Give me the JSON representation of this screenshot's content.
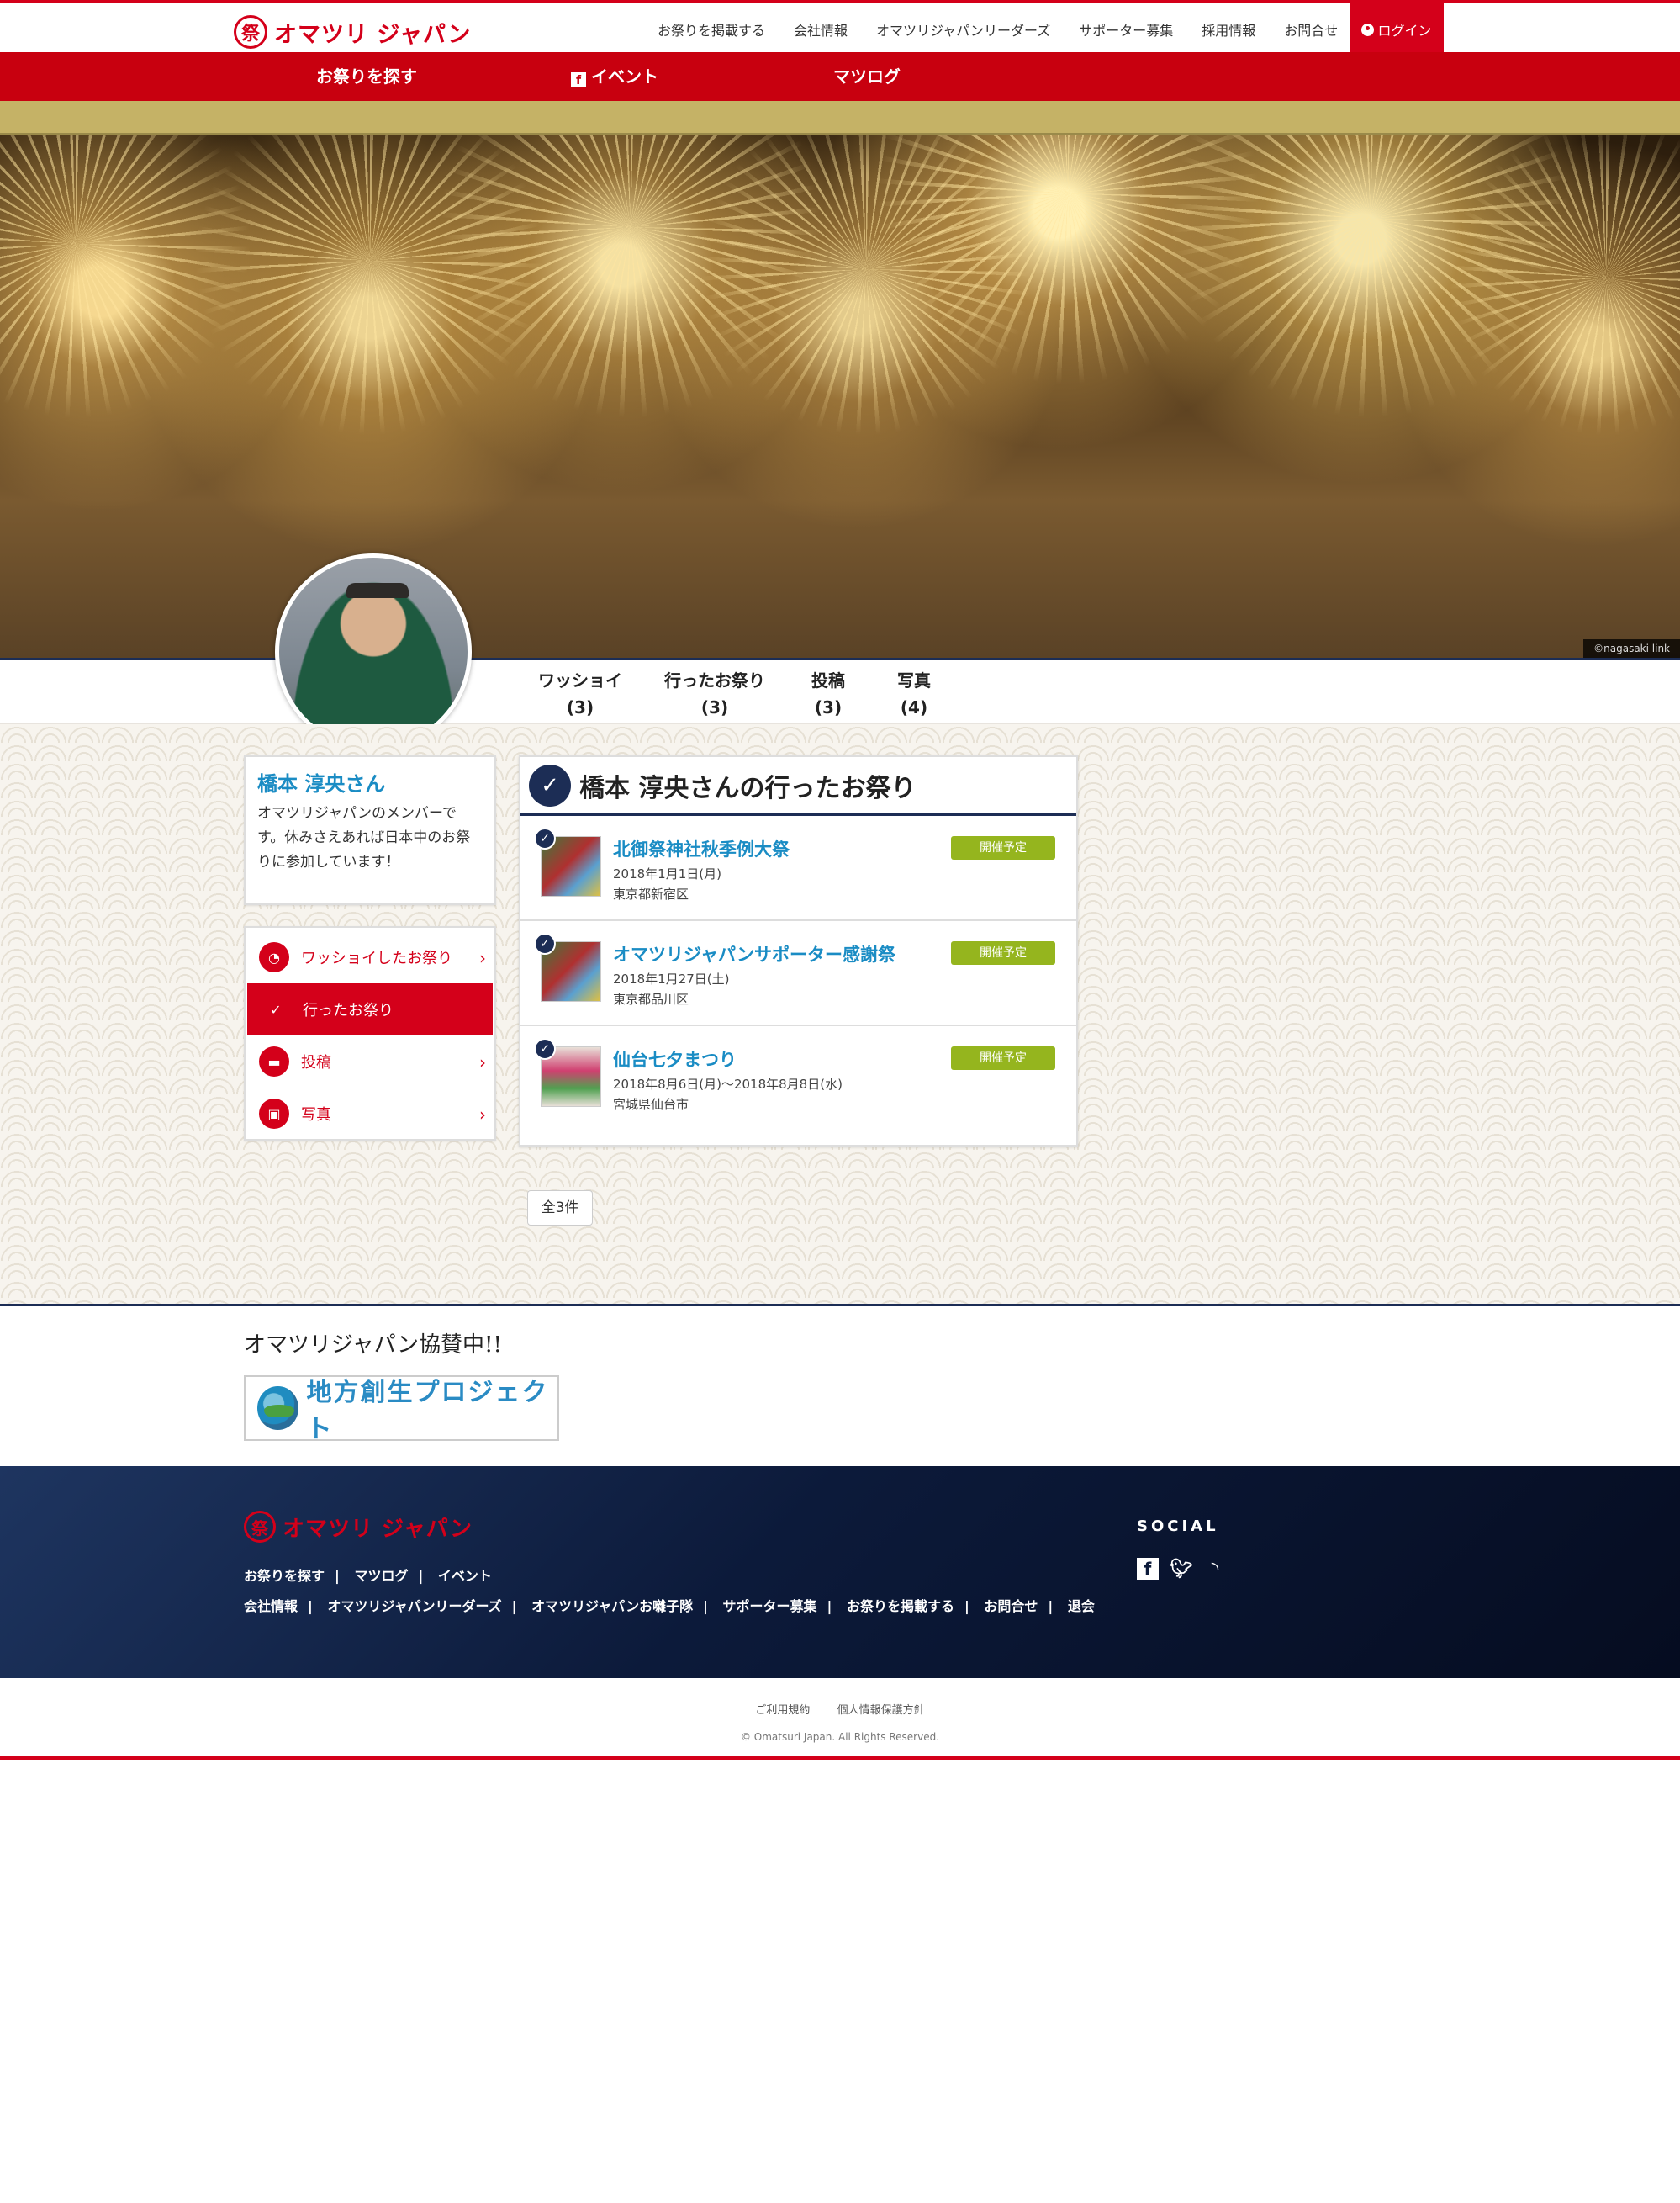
{
  "brand": {
    "logo_mark": "祭",
    "name": "オマツリ ジャパン"
  },
  "topnav": [
    "お祭りを掲載する",
    "会社情報",
    "オマツリジャパンリーダーズ",
    "サポーター募集",
    "採用情報",
    "お問合せ"
  ],
  "login_label": "ログイン",
  "rednav": {
    "search": "お祭りを探す",
    "fb_glyph": "f",
    "event": "イベント",
    "log": "マツログ"
  },
  "hero": {
    "credit": "©nagasaki link"
  },
  "profile_tabs": [
    {
      "label": "ワッショイ",
      "count": "(3)"
    },
    {
      "label": "行ったお祭り",
      "count": "(3)"
    },
    {
      "label": "投稿",
      "count": "(3)"
    },
    {
      "label": "写真",
      "count": "(4)"
    }
  ],
  "profile": {
    "name": "橋本 淳央さん",
    "bio": "オマツリジャパンのメンバーです。休みさえあれば日本中のお祭りに参加しています！"
  },
  "side_menu": [
    {
      "label": "ワッショイしたお祭り",
      "icon": "wasshoi-icon",
      "active": false
    },
    {
      "label": "行ったお祭り",
      "icon": "check-icon",
      "active": true
    },
    {
      "label": "投稿",
      "icon": "comment-icon",
      "active": false
    },
    {
      "label": "写真",
      "icon": "photo-icon",
      "active": false
    }
  ],
  "main": {
    "title": "橋本 淳央さんの行ったお祭り",
    "festivals": [
      {
        "name": "北御祭神社秋季例大祭",
        "date": "2018年1月1日(月)",
        "location": "東京都新宿区",
        "status": "開催予定"
      },
      {
        "name": "オマツリジャパンサポーター感謝祭",
        "date": "2018年1月27日(土)",
        "location": "東京都品川区",
        "status": "開催予定"
      },
      {
        "name": "仙台七夕まつり",
        "date": "2018年8月6日(月)～2018年8月8日(水)",
        "location": "宮城県仙台市",
        "status": "開催予定"
      }
    ],
    "count_label": "全3件"
  },
  "sponsor": {
    "title": "オマツリジャパン協賛中!!",
    "logo_text": "地方創生プロジェクト"
  },
  "footer": {
    "links_row1": [
      "お祭りを探す",
      "マツログ",
      "イベント"
    ],
    "links_row2": [
      "会社情報",
      "オマツリジャパンリーダーズ",
      "オマツリジャパンお囃子隊",
      "サポーター募集",
      "お祭りを掲載する",
      "お問合せ",
      "退会"
    ],
    "social_title": "SOCIAL",
    "social_icons": [
      "facebook-icon",
      "twitter-icon",
      "rss-icon"
    ]
  },
  "bottom": {
    "terms": "ご利用規約",
    "privacy": "個人情報保護方針",
    "copyright": "© Omatsuri Japan. All Rights Reserved."
  },
  "colors": {
    "brand_red": "#d4001a",
    "navy": "#1c2d55",
    "link_blue": "#1a8cc4",
    "status_green": "#95b51e",
    "gold": "#c5b266"
  }
}
